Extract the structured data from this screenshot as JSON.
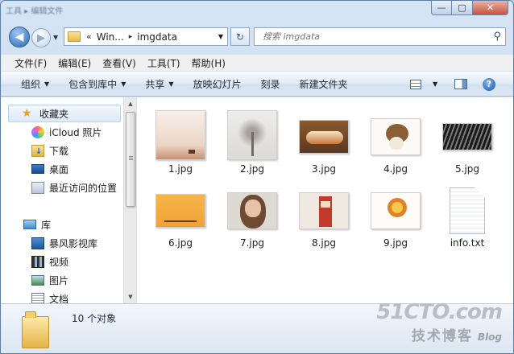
{
  "title": {
    "text": "工具 ▸ 编辑文件"
  },
  "caption": {
    "min": "—",
    "max": "▢",
    "close": "✕"
  },
  "nav": {
    "back": "◀",
    "forward": "▶",
    "dropdown": "▼",
    "refresh": "↻"
  },
  "address": {
    "parent": "Win...",
    "chevrons": "«",
    "separator": "▸",
    "current": "imgdata",
    "dropdown": "▼"
  },
  "search": {
    "placeholder": "搜索 imgdata",
    "icon": "⚲"
  },
  "menu": [
    "文件(F)",
    "编辑(E)",
    "查看(V)",
    "工具(T)",
    "帮助(H)"
  ],
  "toolbar": {
    "organize": "组织",
    "include": "包含到库中",
    "share": "共享",
    "slideshow": "放映幻灯片",
    "burn": "刻录",
    "new_folder": "新建文件夹",
    "help": "?"
  },
  "sidebar": {
    "favorites": "收藏夹",
    "fav_items": [
      "iCloud 照片",
      "下载",
      "桌面",
      "最近访问的位置"
    ],
    "libraries": "库",
    "lib_items": [
      "暴风影视库",
      "视频",
      "图片",
      "文档"
    ]
  },
  "files": [
    {
      "name": "1.jpg",
      "icon": "image-thumbnail-desert"
    },
    {
      "name": "2.jpg",
      "icon": "image-thumbnail-tree"
    },
    {
      "name": "3.jpg",
      "icon": "image-thumbnail-bread"
    },
    {
      "name": "4.jpg",
      "icon": "image-thumbnail-hedgehog"
    },
    {
      "name": "5.jpg",
      "icon": "image-thumbnail-zebras"
    },
    {
      "name": "6.jpg",
      "icon": "image-thumbnail-horizon"
    },
    {
      "name": "7.jpg",
      "icon": "image-thumbnail-portrait"
    },
    {
      "name": "8.jpg",
      "icon": "image-thumbnail-nutcracker"
    },
    {
      "name": "9.jpg",
      "icon": "image-thumbnail-lion"
    },
    {
      "name": "info.txt",
      "icon": "text-document-icon"
    }
  ],
  "status": {
    "count": "10 个对象"
  },
  "watermark": {
    "site": "51CTO.com",
    "sub": "技术博客",
    "blog": "Blog"
  }
}
